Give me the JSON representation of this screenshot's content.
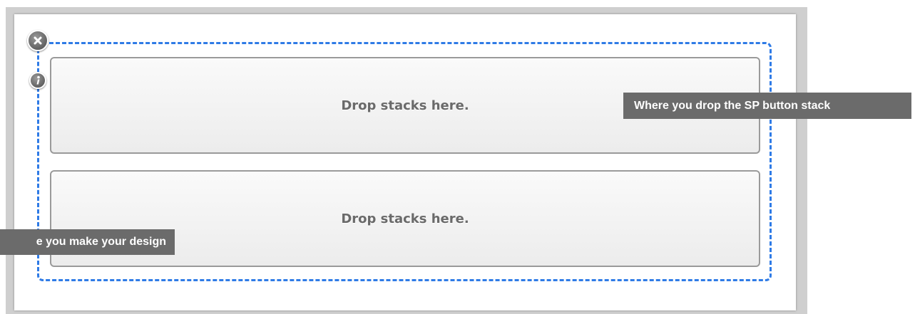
{
  "editor": {
    "drop_zones": [
      {
        "label": "Drop stacks here."
      },
      {
        "label": "Drop stacks here."
      }
    ]
  },
  "callouts": {
    "right": "Where you drop the SP button stack",
    "left": "e you make your design"
  },
  "icons": {
    "close": "close-icon",
    "info": "info-icon"
  },
  "colors": {
    "dashed_border": "#2f7be6",
    "callout_bg": "#6b6b6b"
  }
}
